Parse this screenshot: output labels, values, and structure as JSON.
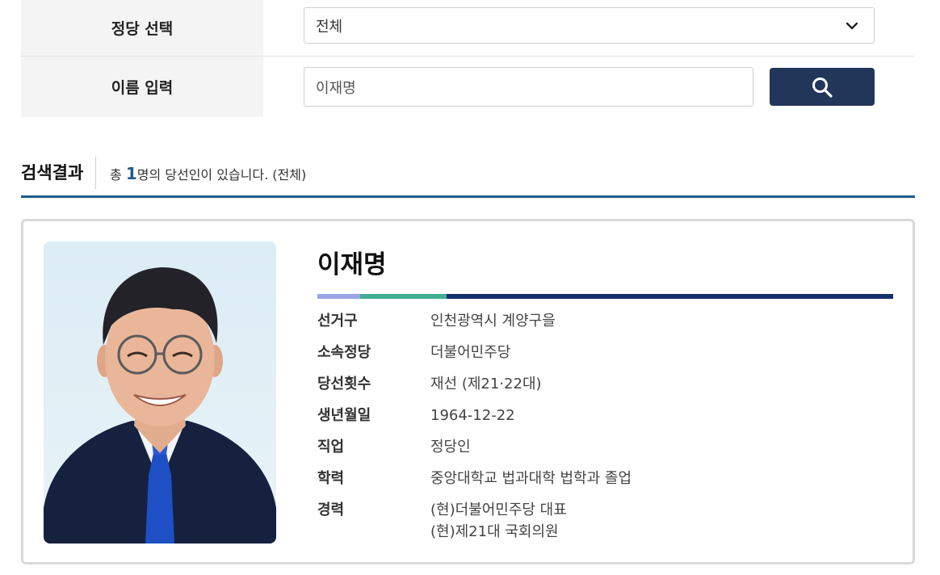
{
  "filter": {
    "party_label": "정당 선택",
    "party_selected": "전체",
    "name_label": "이름 입력",
    "name_value": "이재명"
  },
  "results": {
    "title": "검색결과",
    "summary_prefix": "총",
    "count": "1",
    "summary_suffix": "명의 당선인이 있습니다. (전체)"
  },
  "member": {
    "name": "이재명",
    "fields": [
      {
        "key": "선거구",
        "value": "인천광역시 계양구을"
      },
      {
        "key": "소속정당",
        "value": "더불어민주당"
      },
      {
        "key": "당선횟수",
        "value": "재선 (제21·22대)"
      },
      {
        "key": "생년월일",
        "value": "1964-12-22"
      },
      {
        "key": "직업",
        "value": "정당인"
      },
      {
        "key": "학력",
        "value": "중앙대학교 법과대학 법학과 졸업"
      }
    ],
    "career_key": "경력",
    "career": [
      "(현)더불어민주당 대표",
      "(현)제21대 국회의원"
    ]
  },
  "colors": {
    "accent": "#1f5b8c",
    "button": "#22365a",
    "bar_1": "#9aa5e6",
    "bar_2": "#3fae94",
    "bar_3": "#13306c"
  },
  "icons": {
    "search": "search-icon",
    "dropdown": "chevron-down-icon",
    "portrait": "member-photo"
  }
}
